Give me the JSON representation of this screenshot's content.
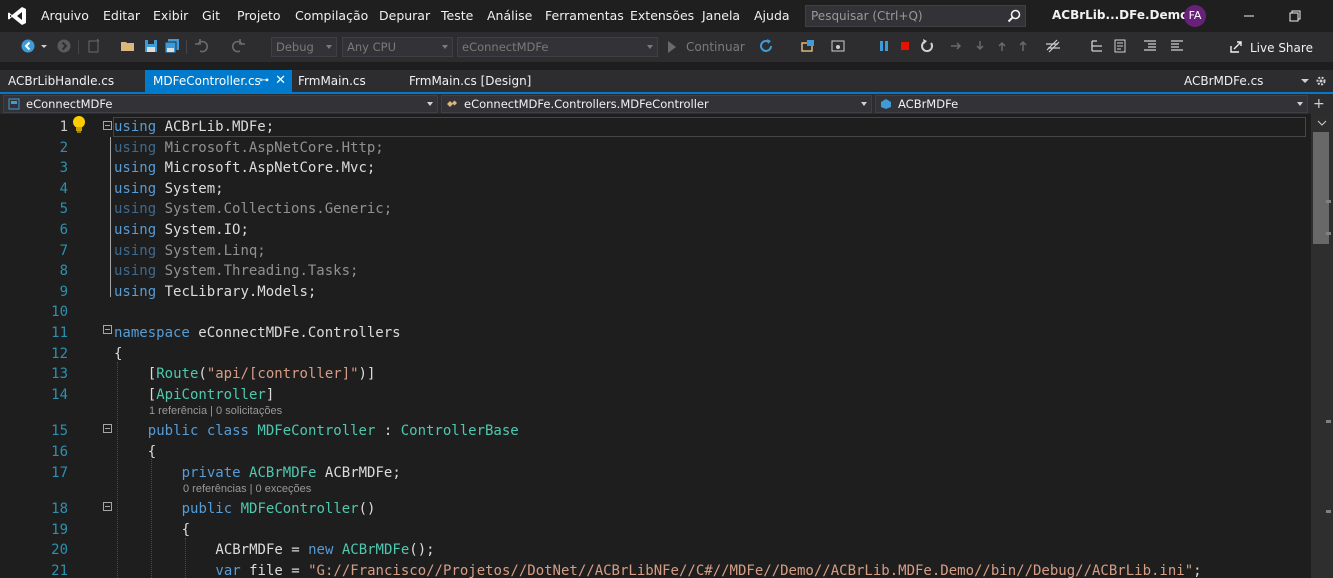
{
  "menu": {
    "items": [
      "Arquivo",
      "Editar",
      "Exibir",
      "Git",
      "Projeto",
      "Compilação",
      "Depurar",
      "Teste",
      "Análise",
      "Ferramentas",
      "Extensões",
      "Janela",
      "Ajuda"
    ],
    "search_placeholder": "Pesquisar (Ctrl+Q)",
    "solution_name": "ACBrLib...DFe.Demo",
    "user_initials": "FA"
  },
  "toolbar": {
    "config": "Debug",
    "platform": "Any CPU",
    "project": "eConnectMDFe",
    "continue_label": "Continuar",
    "liveshare_label": "Live Share"
  },
  "tabs": [
    {
      "label": "ACBrLibHandle.cs",
      "active": false
    },
    {
      "label": "MDFeController.cs",
      "active": true
    },
    {
      "label": "FrmMain.cs",
      "active": false
    },
    {
      "label": "FrmMain.cs [Design]",
      "active": false
    },
    {
      "label": "ACBrMDFe.cs",
      "active": false
    }
  ],
  "navbar": {
    "project": "eConnectMDFe",
    "class": "eConnectMDFe.Controllers.MDFeController",
    "member": "ACBrMDFe"
  },
  "editor": {
    "lines": [
      {
        "n": "1",
        "code": "using ACBrLib.MDFe;"
      },
      {
        "n": "2",
        "code": "using Microsoft.AspNetCore.Http;"
      },
      {
        "n": "3",
        "code": "using Microsoft.AspNetCore.Mvc;"
      },
      {
        "n": "4",
        "code": "using System;"
      },
      {
        "n": "5",
        "code": "using System.Collections.Generic;"
      },
      {
        "n": "6",
        "code": "using System.IO;"
      },
      {
        "n": "7",
        "code": "using System.Linq;"
      },
      {
        "n": "8",
        "code": "using System.Threading.Tasks;"
      },
      {
        "n": "9",
        "code": "using TecLibrary.Models;"
      },
      {
        "n": "10",
        "code": ""
      },
      {
        "n": "11",
        "code": "namespace eConnectMDFe.Controllers"
      },
      {
        "n": "12",
        "code": "{"
      },
      {
        "n": "13",
        "code": "[Route(\"api/[controller]\")]"
      },
      {
        "n": "14",
        "code": "[ApiController]"
      },
      {
        "n": "15",
        "code": "public class MDFeController : ControllerBase"
      },
      {
        "n": "16",
        "code": "{"
      },
      {
        "n": "17",
        "code": "private ACBrMDFe ACBrMDFe;"
      },
      {
        "n": "18",
        "code": "public MDFeController()"
      },
      {
        "n": "19",
        "code": "{"
      },
      {
        "n": "20",
        "code": "ACBrMDFe = new ACBrMDFe();"
      },
      {
        "n": "21",
        "code": "var file = \"G://Francisco//Projetos//DotNet//ACBrLibNFe//C#//MDFe//Demo//ACBrLib.MDFe.Demo//bin//Debug//ACBrLib.ini\";"
      }
    ],
    "codelens": [
      "1 referência | 0 solicitações",
      "0 referências | 0 exceções"
    ]
  }
}
